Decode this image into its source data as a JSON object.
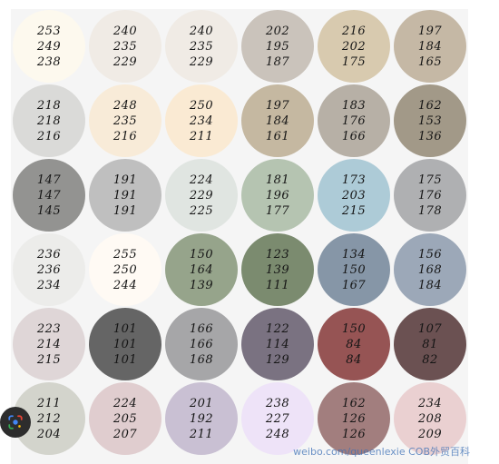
{
  "swatches": [
    {
      "values": [
        "253",
        "249",
        "238"
      ],
      "color": "#fdf9ee"
    },
    {
      "values": [
        "240",
        "235",
        "229"
      ],
      "color": "#f0ebe5"
    },
    {
      "values": [
        "240",
        "235",
        "229"
      ],
      "color": "#f0ebe5"
    },
    {
      "values": [
        "202",
        "195",
        "187"
      ],
      "color": "#cac3bb"
    },
    {
      "values": [
        "216",
        "202",
        "175"
      ],
      "color": "#d8caaf"
    },
    {
      "values": [
        "197",
        "184",
        "165"
      ],
      "color": "#c5b8a5"
    },
    {
      "values": [
        "218",
        "218",
        "216"
      ],
      "color": "#dadad8"
    },
    {
      "values": [
        "248",
        "235",
        "216"
      ],
      "color": "#f8ebd8"
    },
    {
      "values": [
        "250",
        "234",
        "211"
      ],
      "color": "#faead3"
    },
    {
      "values": [
        "197",
        "184",
        "161"
      ],
      "color": "#c5b8a1"
    },
    {
      "values": [
        "183",
        "176",
        "166"
      ],
      "color": "#b7b0a6"
    },
    {
      "values": [
        "162",
        "153",
        "136"
      ],
      "color": "#a29988"
    },
    {
      "values": [
        "147",
        "147",
        "145"
      ],
      "color": "#939391"
    },
    {
      "values": [
        "191",
        "191",
        "191"
      ],
      "color": "#bfbfbf"
    },
    {
      "values": [
        "224",
        "229",
        "225"
      ],
      "color": "#e0e5e1"
    },
    {
      "values": [
        "181",
        "196",
        "177"
      ],
      "color": "#b5c4b1"
    },
    {
      "values": [
        "173",
        "203",
        "215"
      ],
      "color": "#adcbd7"
    },
    {
      "values": [
        "175",
        "176",
        "178"
      ],
      "color": "#afb0b2"
    },
    {
      "values": [
        "236",
        "236",
        "234"
      ],
      "color": "#ececea"
    },
    {
      "values": [
        "255",
        "250",
        "244"
      ],
      "color": "#fffaf4"
    },
    {
      "values": [
        "150",
        "164",
        "139"
      ],
      "color": "#96a48b"
    },
    {
      "values": [
        "123",
        "139",
        "111"
      ],
      "color": "#7b8b6f"
    },
    {
      "values": [
        "134",
        "150",
        "167"
      ],
      "color": "#8696a7"
    },
    {
      "values": [
        "156",
        "168",
        "184"
      ],
      "color": "#9ca8b8"
    },
    {
      "values": [
        "223",
        "214",
        "215"
      ],
      "color": "#dfd6d7"
    },
    {
      "values": [
        "101",
        "101",
        "101"
      ],
      "color": "#656565"
    },
    {
      "values": [
        "166",
        "166",
        "168"
      ],
      "color": "#a6a6a8"
    },
    {
      "values": [
        "122",
        "114",
        "129"
      ],
      "color": "#7a7281"
    },
    {
      "values": [
        "150",
        "84",
        "84"
      ],
      "color": "#965454"
    },
    {
      "values": [
        "107",
        "81",
        "82"
      ],
      "color": "#6b5152"
    },
    {
      "values": [
        "211",
        "212",
        "204"
      ],
      "color": "#d3d4cc"
    },
    {
      "values": [
        "224",
        "205",
        "207"
      ],
      "color": "#e0cdcf"
    },
    {
      "values": [
        "201",
        "192",
        "211"
      ],
      "color": "#c9c0d3"
    },
    {
      "values": [
        "238",
        "227",
        "248"
      ],
      "color": "#eee3f8"
    },
    {
      "values": [
        "162",
        "126",
        "126"
      ],
      "color": "#a27e7e"
    },
    {
      "values": [
        "234",
        "208",
        "209"
      ],
      "color": "#ead0d1"
    }
  ],
  "watermark": "weibo.com/queenlexie  COB外贸百科",
  "lens_icon": "google-lens-icon",
  "lens_colors": [
    "#4285f4",
    "#ea4335",
    "#fbbc05",
    "#34a853"
  ]
}
